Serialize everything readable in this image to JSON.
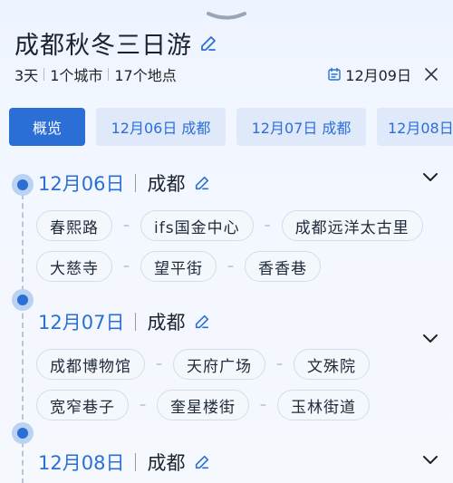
{
  "header": {
    "title": "成都秋冬三日游",
    "meta": [
      "3天",
      "1个城市",
      "17个地点"
    ],
    "date": "12月09日"
  },
  "tabs": [
    {
      "label": "概览",
      "active": true
    },
    {
      "label": "12月06日 成都",
      "active": false
    },
    {
      "label": "12月07日 成都",
      "active": false
    },
    {
      "label": "12月08日",
      "active": false
    }
  ],
  "days": [
    {
      "date": "12月06日",
      "city": "成都",
      "rows": [
        [
          "春熙路",
          "ifs国金中心",
          "成都远洋太古里"
        ],
        [
          "大慈寺",
          "望平街",
          "香香巷"
        ]
      ]
    },
    {
      "date": "12月07日",
      "city": "成都",
      "rows": [
        [
          "成都博物馆",
          "天府广场",
          "文殊院"
        ],
        [
          "宽窄巷子",
          "奎星楼街",
          "玉林街道"
        ]
      ]
    },
    {
      "date": "12月08日",
      "city": "成都",
      "rows": []
    }
  ],
  "colors": {
    "accent": "#2b6fd6",
    "tab_bg": "#dfe9fa"
  }
}
